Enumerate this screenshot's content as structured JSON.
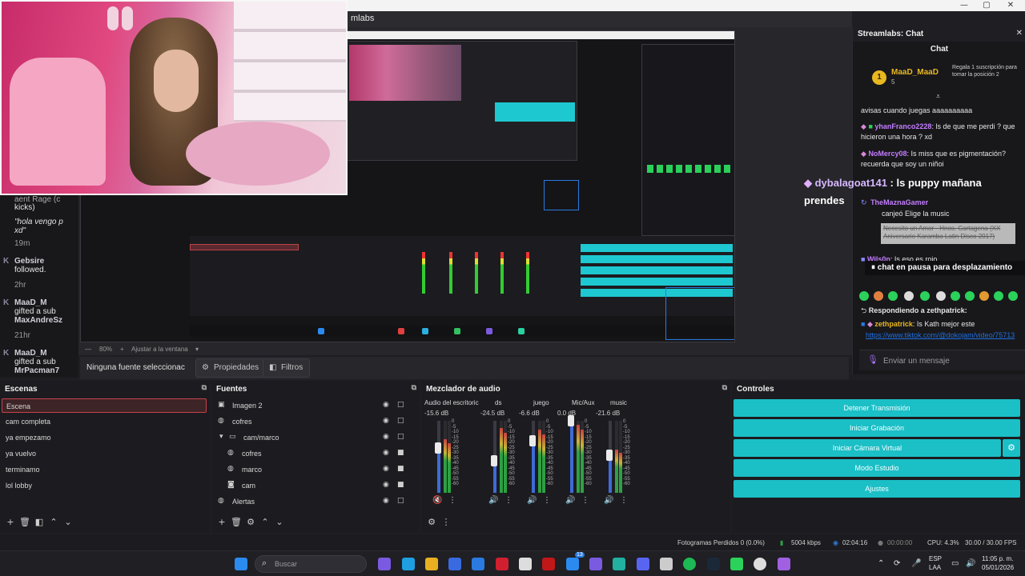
{
  "app": {
    "title_partial": "mlabs",
    "window_controls": [
      "—",
      "▢",
      "✕"
    ]
  },
  "overlay": {
    "dyb_name": "dybalagoat141",
    "dyb_msg": " : ls puppy mañana",
    "prendes": "prendes"
  },
  "left_chat": {
    "lines": [
      {
        "text": "aent Rage (c"
      },
      {
        "text": "kicks)"
      },
      {
        "text": "\"hola vengo p"
      },
      {
        "text": "xd\""
      },
      {
        "text": "19m"
      },
      {
        "text": "Gebsire"
      },
      {
        "text": "followed."
      },
      {
        "text": "2hr"
      },
      {
        "text": "MaaD_M"
      },
      {
        "text": "gifted a sub"
      },
      {
        "text": "MaxAndreSz"
      },
      {
        "text": "21hr"
      },
      {
        "text": "MaaD_M"
      },
      {
        "text": "gifted a sub"
      },
      {
        "text": "MrPacman7"
      }
    ]
  },
  "preview_toolbar": {
    "zoom": "80%",
    "fit": "Ajustar a la ventana"
  },
  "source_toolbar": {
    "no_source": "Ninguna fuente seleccionac",
    "properties_label": "Propiedades",
    "filters_label": "Filtros"
  },
  "scenes": {
    "title": "Escenas",
    "items": [
      "Escena",
      "cam completa",
      "ya empezamo",
      "ya vuelvo",
      "terminamo",
      "lol lobby"
    ],
    "active_index": 0
  },
  "sources": {
    "title": "Fuentes",
    "items": [
      {
        "label": "Imagen 2",
        "icon": "image-icon",
        "glyph": "▣",
        "indent": 0,
        "locked": false
      },
      {
        "label": "cofres",
        "icon": "browser-icon",
        "glyph": "◍",
        "indent": 0,
        "locked": false
      },
      {
        "label": "cam/marco",
        "icon": "folder-icon",
        "glyph": "▭",
        "indent": 0,
        "locked": false,
        "group": true
      },
      {
        "label": "cofres",
        "icon": "browser-icon",
        "glyph": "◍",
        "indent": 1,
        "locked": true
      },
      {
        "label": "marco",
        "icon": "browser-icon",
        "glyph": "◍",
        "indent": 1,
        "locked": true
      },
      {
        "label": "cam",
        "icon": "camera-icon",
        "glyph": "◙",
        "indent": 1,
        "locked": true
      },
      {
        "label": "Alertas",
        "icon": "browser-icon",
        "glyph": "◍",
        "indent": 0,
        "locked": false
      }
    ]
  },
  "mixer": {
    "title": "Mezclador de audio",
    "channels": [
      {
        "name": "Audio del escritoric",
        "db": "-15.6 dB",
        "fader": 0.62,
        "level": 0.75,
        "muted": true
      },
      {
        "name": "ds",
        "db": "-24.5 dB",
        "fader": 0.45,
        "level": 0.9,
        "muted": false
      },
      {
        "name": "juego",
        "db": "-6.6 dB",
        "fader": 0.72,
        "level": 0.88,
        "muted": false
      },
      {
        "name": "Mic/Aux",
        "db": "0.0 dB",
        "fader": 1.0,
        "level": 0.95,
        "muted": false
      },
      {
        "name": "music",
        "db": "-21.6 dB",
        "fader": 0.52,
        "level": 0.6,
        "muted": false
      }
    ],
    "scale": [
      "0",
      "-5",
      "-10",
      "-15",
      "-20",
      "-25",
      "-30",
      "-35",
      "-40",
      "-45",
      "-50",
      "-55",
      "-60"
    ]
  },
  "controls": {
    "title": "Controles",
    "buttons": [
      "Detener Transmisión",
      "Iniciar Grabación",
      "Iniciar Cámara Virtual",
      "Modo Estudio",
      "Ajustes"
    ]
  },
  "status": {
    "dropped": "Fotogramas Perdidos 0 (0.0%)",
    "bitrate": "5004 kbps",
    "live_time": "02:04:16",
    "rec_time": "00:00:00",
    "cpu": "CPU: 4.3%",
    "fps": "30.00 / 30.00 FPS"
  },
  "taskbar": {
    "search_placeholder": "Buscar",
    "lang_1": "ESP",
    "lang_2": "LAA",
    "time": "11:05 p. m.",
    "date": "05/01/2026",
    "badge": "13"
  },
  "chat": {
    "panel_title": "Streamlabs: Chat",
    "title": "Chat",
    "gifter_name": "MaaD_MaaD",
    "gifter_count": "5",
    "gifter_note": "Regala 1 suscripción para tomar la posición 2",
    "messages": [
      {
        "user": "",
        "text": "avisas cuando juegas aaaaaaaaaa",
        "color": "#e6e6e6"
      },
      {
        "user": "yhanFranco2228",
        "text": ": ls de que me perdi ? que hicieron una hora ? xd",
        "color": "#c37cff"
      },
      {
        "user": "NoMercy08",
        "text": ": Is miss que es pigmentación? recuerda que soy un niñoi",
        "color": "#c37cff"
      },
      {
        "user": "TheMaznaGamer",
        "text": "",
        "color": "#c37cff"
      },
      {
        "user": "",
        "text": "canjeó Elige la music",
        "color": "#e6e6e6"
      },
      {
        "user": "Wils0n",
        "text": ": Is eso es roio",
        "color": "#c37cff"
      }
    ],
    "quoted": "Necesito un Amor - Hnos. Cartagena (XX Aniversario Karamba Latin Disco 2017)",
    "pause_banner": "chat en pausa para desplazamiento",
    "reply_label": "Respondiendo a zethpatrick:",
    "reply_user": "zethpatrick",
    "reply_text": ": Is Kath mejor este",
    "reply_link": "https://www.tiktok.com/@dokojam/video/75713",
    "input_placeholder": "Enviar un mensaje"
  }
}
